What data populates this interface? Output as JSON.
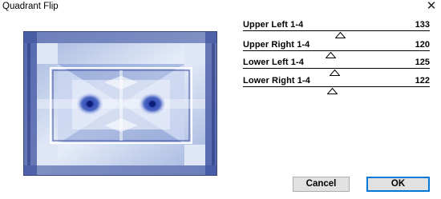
{
  "window": {
    "title": "Quadrant Flip",
    "close_glyph": "✕"
  },
  "preview": {
    "icon": "quadrant-flip-preview-image"
  },
  "sliders": [
    {
      "label": "Upper Left 1-4",
      "value": "133",
      "fraction": 0.52
    },
    {
      "label": "Upper Right 1-4",
      "value": "120",
      "fraction": 0.47
    },
    {
      "label": "Lower Left 1-4",
      "value": "125",
      "fraction": 0.49
    },
    {
      "label": "Lower Right 1-4",
      "value": "122",
      "fraction": 0.48
    }
  ],
  "buttons": {
    "cancel": "Cancel",
    "ok": "OK"
  },
  "colors": {
    "preview_dark": "#2b3f8c",
    "preview_light": "#dfe7f6",
    "ok_border": "#0078d7"
  }
}
